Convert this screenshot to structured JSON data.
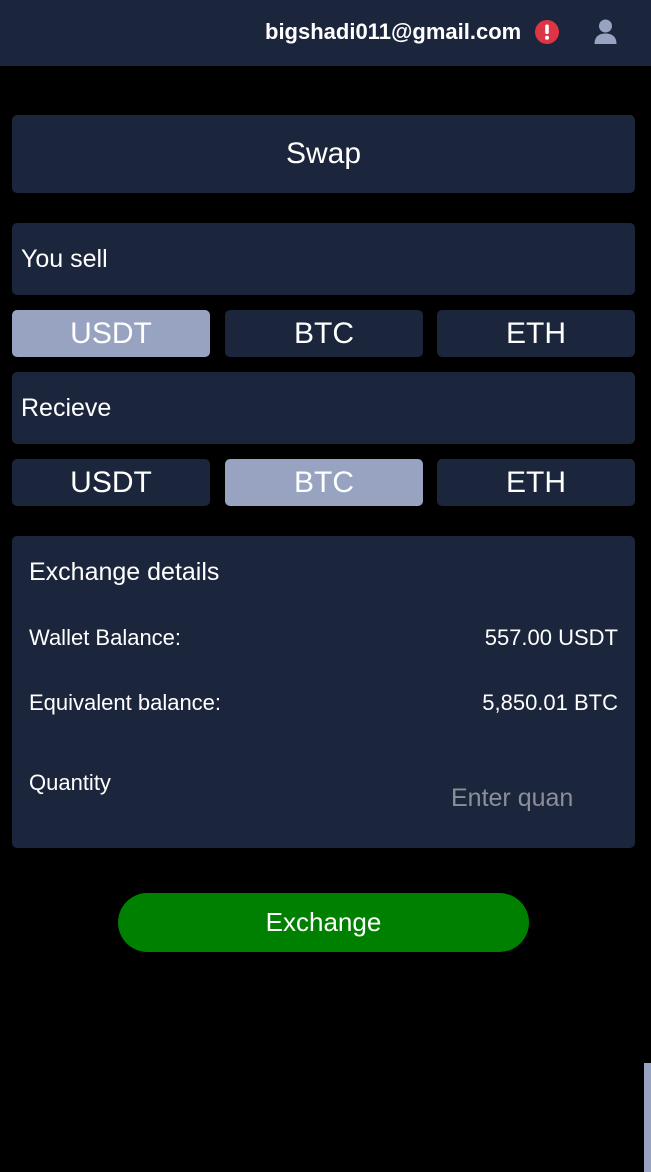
{
  "header": {
    "email": "bigshadi011@gmail.com",
    "alert_icon": "exclamation-circle-icon",
    "alert_color": "#dc3545",
    "user_icon": "user-icon"
  },
  "swap": {
    "title": "Swap"
  },
  "sell": {
    "label": "You sell",
    "options": [
      "USDT",
      "BTC",
      "ETH"
    ],
    "selected": "USDT"
  },
  "receive": {
    "label": "Recieve",
    "options": [
      "USDT",
      "BTC",
      "ETH"
    ],
    "selected": "BTC"
  },
  "details": {
    "title": "Exchange details",
    "wallet_label": "Wallet Balance:",
    "wallet_value": "557.00 USDT",
    "equiv_label": "Equivalent balance:",
    "equiv_value": "5,850.01 BTC",
    "quantity_label": "Quantity",
    "quantity_placeholder": "Enter quan",
    "quantity_value": ""
  },
  "actions": {
    "exchange_label": "Exchange"
  },
  "colors": {
    "background": "#000000",
    "card": "#1b253b",
    "active_option": "#97a3c1",
    "exchange_button": "#008000"
  }
}
